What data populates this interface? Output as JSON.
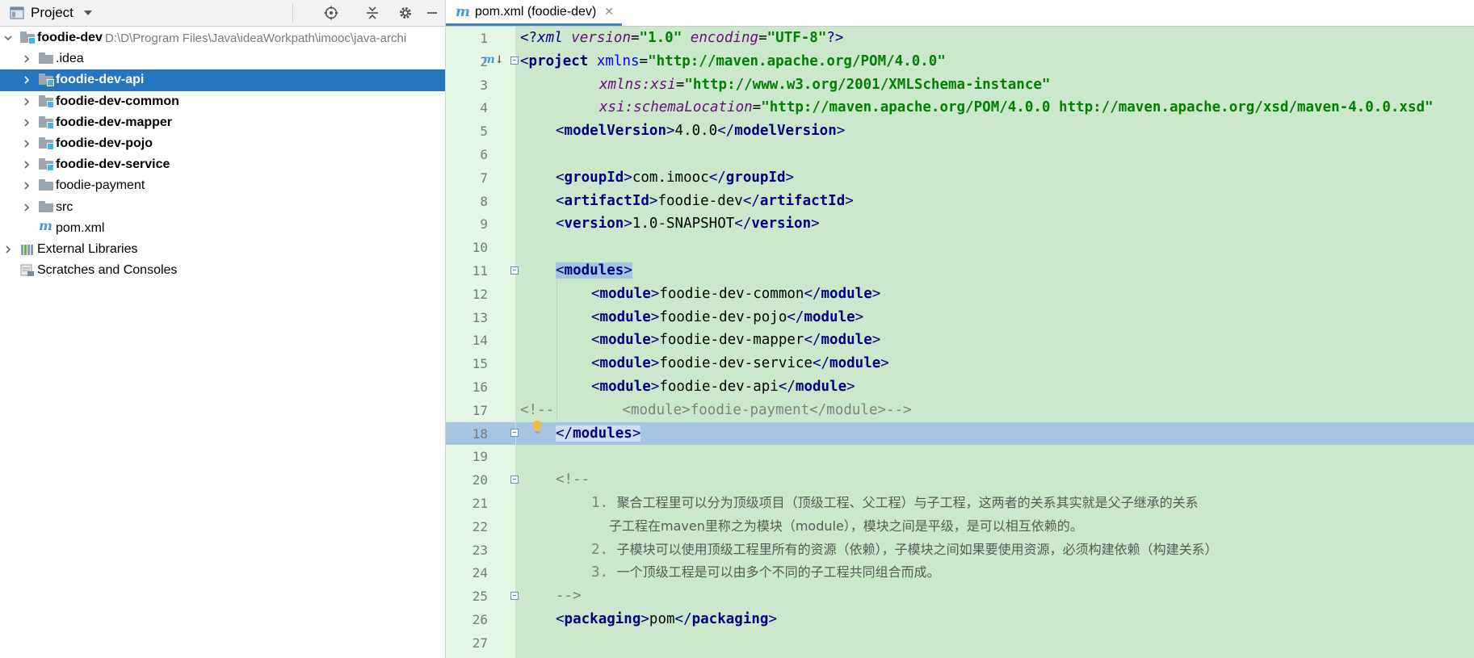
{
  "project_panel": {
    "title": "Project",
    "tree": [
      {
        "label": "foodie-dev",
        "path": "D:\\D\\Program Files\\Java\\ideaWorkpath\\imooc\\java-archi",
        "bold": true,
        "level": 0,
        "arrow": "expanded",
        "icon": "module-folder-icon"
      },
      {
        "label": ".idea",
        "bold": false,
        "level": 1,
        "arrow": "collapsed",
        "icon": "folder-icon"
      },
      {
        "label": "foodie-dev-api",
        "bold": true,
        "level": 1,
        "arrow": "collapsed",
        "icon": "module-folder-icon",
        "selected": true
      },
      {
        "label": "foodie-dev-common",
        "bold": true,
        "level": 1,
        "arrow": "collapsed",
        "icon": "module-folder-icon"
      },
      {
        "label": "foodie-dev-mapper",
        "bold": true,
        "level": 1,
        "arrow": "collapsed",
        "icon": "module-folder-icon"
      },
      {
        "label": "foodie-dev-pojo",
        "bold": true,
        "level": 1,
        "arrow": "collapsed",
        "icon": "module-folder-icon"
      },
      {
        "label": "foodie-dev-service",
        "bold": true,
        "level": 1,
        "arrow": "collapsed",
        "icon": "module-folder-icon"
      },
      {
        "label": "foodie-payment",
        "bold": false,
        "level": 1,
        "arrow": "collapsed",
        "icon": "folder-icon"
      },
      {
        "label": "src",
        "bold": false,
        "level": 1,
        "arrow": "collapsed",
        "icon": "folder-icon"
      },
      {
        "label": "pom.xml",
        "bold": false,
        "level": 1,
        "arrow": "none",
        "icon": "maven-file-icon"
      },
      {
        "label": "External Libraries",
        "bold": false,
        "level": 0,
        "arrow": "collapsed",
        "icon": "libraries-icon"
      },
      {
        "label": "Scratches and Consoles",
        "bold": false,
        "level": 0,
        "arrow": "none",
        "icon": "scratches-icon"
      }
    ]
  },
  "editor": {
    "tab_icon": "m",
    "tab_label": "pom.xml (foodie-dev)",
    "line_numbers": [
      "1",
      "2",
      "3",
      "4",
      "5",
      "6",
      "7",
      "8",
      "9",
      "10",
      "11",
      "12",
      "13",
      "14",
      "15",
      "16",
      "17",
      "18",
      "19",
      "20",
      "21",
      "22",
      "23",
      "24",
      "25",
      "26",
      "27"
    ],
    "code": {
      "l1": {
        "open": "<?",
        "kw": "xml",
        "a1": "version",
        "eq": "=",
        "v1": "\"1.0\"",
        "a2": "encoding",
        "v2": "\"UTF-8\"",
        "close": "?>"
      },
      "l2": {
        "tag": "project",
        "attr": "xmlns",
        "val": "\"http://maven.apache.org/POM/4.0.0\""
      },
      "l3": {
        "ns": "xmlns",
        "colon": ":",
        "attr": "xsi",
        "val": "\"http://www.w3.org/2001/XMLSchema-instance\""
      },
      "l4": {
        "ns": "xsi",
        "colon": ":",
        "attr": "schemaLocation",
        "val": "\"http://maven.apache.org/POM/4.0.0 http://maven.apache.org/xsd/maven-4.0.0.xsd\""
      },
      "l5": {
        "tag": "modelVersion",
        "text": "4.0.0"
      },
      "l7": {
        "tag": "groupId",
        "text": "com.imooc"
      },
      "l8": {
        "tag": "artifactId",
        "text": "foodie-dev"
      },
      "l9": {
        "tag": "version",
        "text": "1.0-SNAPSHOT"
      },
      "l11": {
        "tag": "modules"
      },
      "modules": [
        "foodie-dev-common",
        "foodie-dev-pojo",
        "foodie-dev-mapper",
        "foodie-dev-service",
        "foodie-dev-api"
      ],
      "module_tag": "module",
      "l17": "<!--        <module>foodie-payment</module>-->",
      "l18": {
        "tag": "modules"
      },
      "l20": "<!--",
      "l21_num": "1.",
      "l21": "聚合工程里可以分为顶级项目（顶级工程、父工程）与子工程，这两者的关系其实就是父子继承的关系",
      "l22": "子工程在maven里称之为模块（module），模块之间是平级，是可以相互依赖的。",
      "l23_num": "2.",
      "l23": "子模块可以使用顶级工程里所有的资源（依赖），子模块之间如果要使用资源，必须构建依赖（构建关系）",
      "l24_num": "3.",
      "l24": "一个顶级工程是可以由多个不同的子工程共同组合而成。",
      "l25": "-->",
      "l26": {
        "tag": "packaging",
        "text": "pom"
      }
    }
  }
}
